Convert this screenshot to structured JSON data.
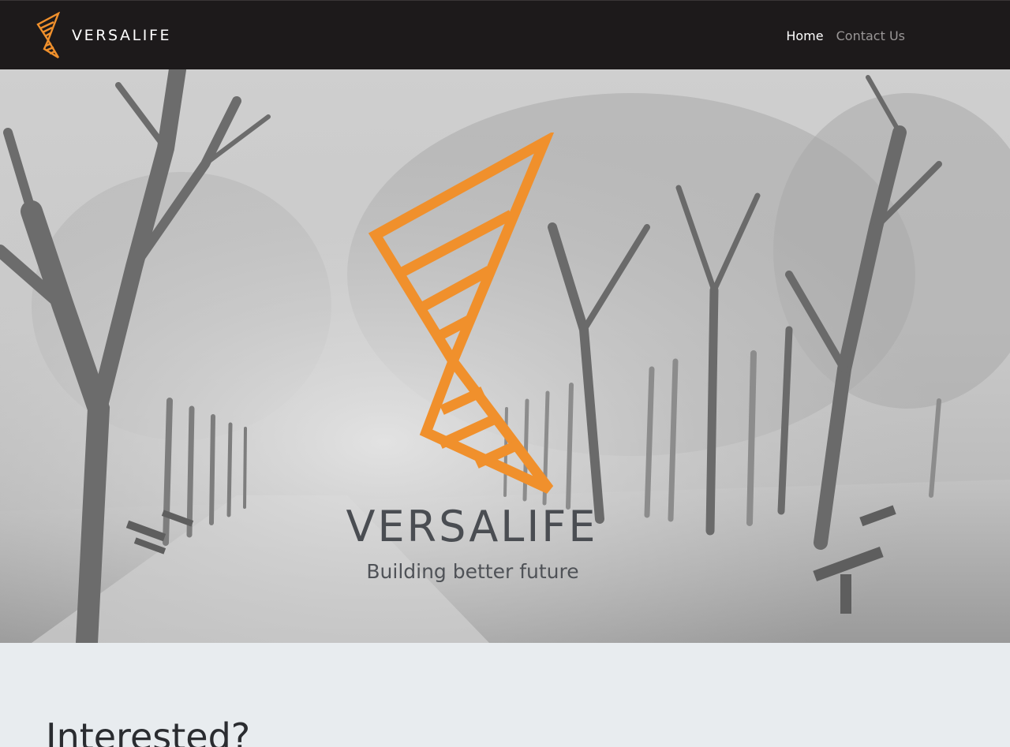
{
  "navbar": {
    "brand_name": "VERSALIFE",
    "links": [
      {
        "label": "Home",
        "active": true
      },
      {
        "label": "Contact Us",
        "active": false
      }
    ]
  },
  "hero": {
    "title": "VERSALIFE",
    "subtitle": "Building better future"
  },
  "section": {
    "heading": "Interested?"
  },
  "colors": {
    "navbar_bg": "#1d1a1b",
    "brand_orange": "#f0902c",
    "hero_text": "#4a4d52",
    "section_bg": "#e8ecef"
  },
  "icons": {
    "brand_logo": "versalife-triangle-logo",
    "hero_logo": "versalife-triangle-logo"
  }
}
